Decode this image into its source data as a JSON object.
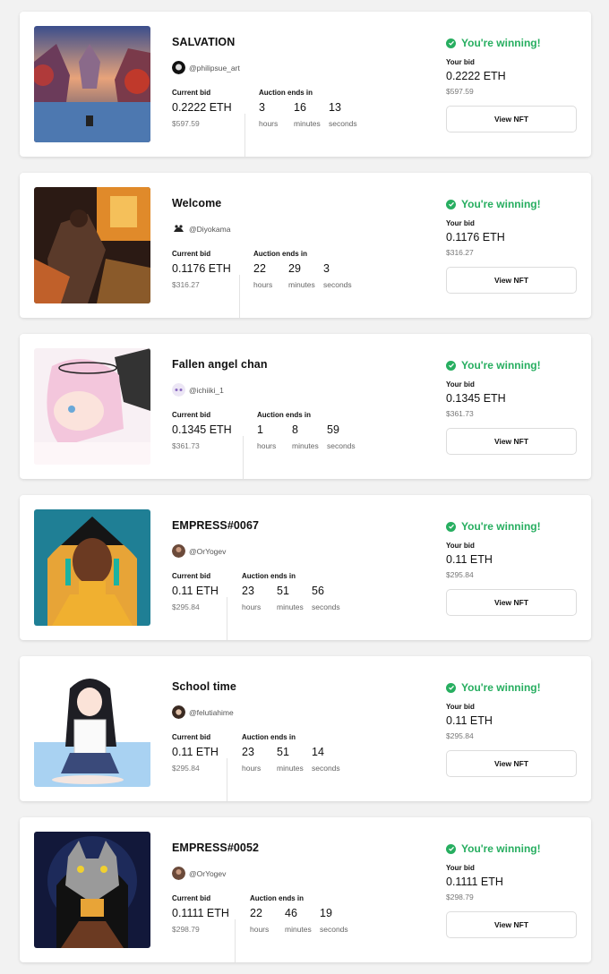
{
  "labels": {
    "current_bid": "Current bid",
    "auction_ends": "Auction ends in",
    "hours": "hours",
    "minutes": "minutes",
    "seconds": "seconds",
    "your_bid": "Your bid",
    "view_button": "View NFT"
  },
  "colors": {
    "winning": "#27ae60"
  },
  "items": [
    {
      "title": "SALVATION",
      "creator": "@philipsue_art",
      "current_bid": "0.2222 ETH",
      "current_usd": "$597.59",
      "hours": "3",
      "minutes": "16",
      "seconds": "13",
      "status": "You're winning!",
      "your_bid": "0.2222 ETH",
      "your_usd": "$597.59"
    },
    {
      "title": "Welcome",
      "creator": "@Diyokama",
      "current_bid": "0.1176 ETH",
      "current_usd": "$316.27",
      "hours": "22",
      "minutes": "29",
      "seconds": "3",
      "status": "You're winning!",
      "your_bid": "0.1176 ETH",
      "your_usd": "$316.27"
    },
    {
      "title": "Fallen angel chan",
      "creator": "@ichiiki_1",
      "current_bid": "0.1345 ETH",
      "current_usd": "$361.73",
      "hours": "1",
      "minutes": "8",
      "seconds": "59",
      "status": "You're winning!",
      "your_bid": "0.1345 ETH",
      "your_usd": "$361.73"
    },
    {
      "title": "EMPRESS#0067",
      "creator": "@OrYogev",
      "current_bid": "0.11 ETH",
      "current_usd": "$295.84",
      "hours": "23",
      "minutes": "51",
      "seconds": "56",
      "status": "You're winning!",
      "your_bid": "0.11 ETH",
      "your_usd": "$295.84"
    },
    {
      "title": "School time",
      "creator": "@felutiahime",
      "current_bid": "0.11 ETH",
      "current_usd": "$295.84",
      "hours": "23",
      "minutes": "51",
      "seconds": "14",
      "status": "You're winning!",
      "your_bid": "0.11 ETH",
      "your_usd": "$295.84"
    },
    {
      "title": "EMPRESS#0052",
      "creator": "@OrYogev",
      "current_bid": "0.1111 ETH",
      "current_usd": "$298.79",
      "hours": "22",
      "minutes": "46",
      "seconds": "19",
      "status": "You're winning!",
      "your_bid": "0.1111 ETH",
      "your_usd": "$298.79"
    }
  ]
}
